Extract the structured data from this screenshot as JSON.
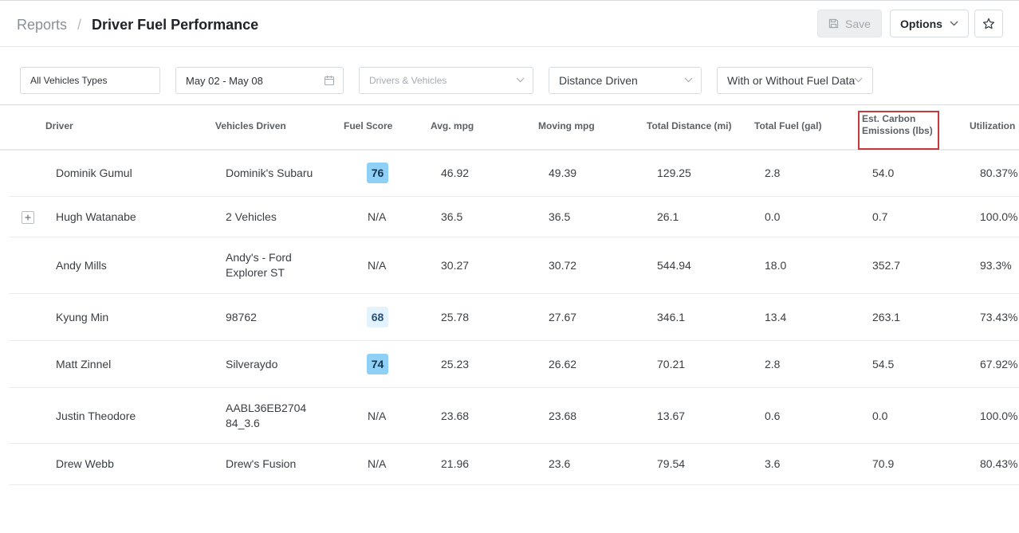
{
  "breadcrumb": {
    "root": "Reports",
    "separator": "/",
    "current": "Driver Fuel Performance"
  },
  "toolbar": {
    "save_label": "Save",
    "options_label": "Options"
  },
  "filters": {
    "vehicle_types": "All Vehicles Types",
    "date_range": "May 02 - May 08",
    "drivers_vehicles_placeholder": "Drivers & Vehicles",
    "metric": "Distance Driven",
    "fuel_data": "With or Without Fuel Data"
  },
  "table": {
    "columns": {
      "driver": "Driver",
      "vehicles": "Vehicles Driven",
      "fuel_score": "Fuel Score",
      "avg_mpg": "Avg. mpg",
      "moving_mpg": "Moving mpg",
      "distance": "Total Distance (mi)",
      "fuel": "Total Fuel (gal)",
      "carbon": "Est. Carbon Emissions (lbs)",
      "utilization": "Utilization"
    },
    "rows": [
      {
        "driver": "Dominik Gumul",
        "vehicles": "Dominik's Subaru",
        "score": "76",
        "avg": "46.92",
        "moving": "49.39",
        "distance": "129.25",
        "fuel": "2.8",
        "carbon": "54.0",
        "util": "80.37%"
      },
      {
        "driver": "Hugh Watanabe",
        "vehicles": "2 Vehicles",
        "score": "N/A",
        "avg": "36.5",
        "moving": "36.5",
        "distance": "26.1",
        "fuel": "0.0",
        "carbon": "0.7",
        "util": "100.0%"
      },
      {
        "driver": "Andy Mills",
        "vehicles": "Andy's - Ford Explorer ST",
        "score": "N/A",
        "avg": "30.27",
        "moving": "30.72",
        "distance": "544.94",
        "fuel": "18.0",
        "carbon": "352.7",
        "util": "93.3%"
      },
      {
        "driver": "Kyung Min",
        "vehicles": "98762",
        "score": "68",
        "avg": "25.78",
        "moving": "27.67",
        "distance": "346.1",
        "fuel": "13.4",
        "carbon": "263.1",
        "util": "73.43%"
      },
      {
        "driver": "Matt Zinnel",
        "vehicles": "Silveraydo",
        "score": "74",
        "avg": "25.23",
        "moving": "26.62",
        "distance": "70.21",
        "fuel": "2.8",
        "carbon": "54.5",
        "util": "67.92%"
      },
      {
        "driver": "Justin Theodore",
        "vehicles": "AABL36EB270484_3.6",
        "score": "N/A",
        "avg": "23.68",
        "moving": "23.68",
        "distance": "13.67",
        "fuel": "0.6",
        "carbon": "0.0",
        "util": "100.0%"
      },
      {
        "driver": "Drew Webb",
        "vehicles": "Drew's Fusion",
        "score": "N/A",
        "avg": "21.96",
        "moving": "23.6",
        "distance": "79.54",
        "fuel": "3.6",
        "carbon": "70.9",
        "util": "80.43%"
      }
    ]
  },
  "colors": {
    "score_high": "#8fd0f7",
    "score_mid": "#e3f3fd",
    "highlight": "#c9373b"
  },
  "icons": {
    "save": "floppy-disk-icon",
    "options": "chevron-down-icon",
    "favorite": "star-icon",
    "calendar": "calendar-icon",
    "expand": "plus-icon"
  }
}
